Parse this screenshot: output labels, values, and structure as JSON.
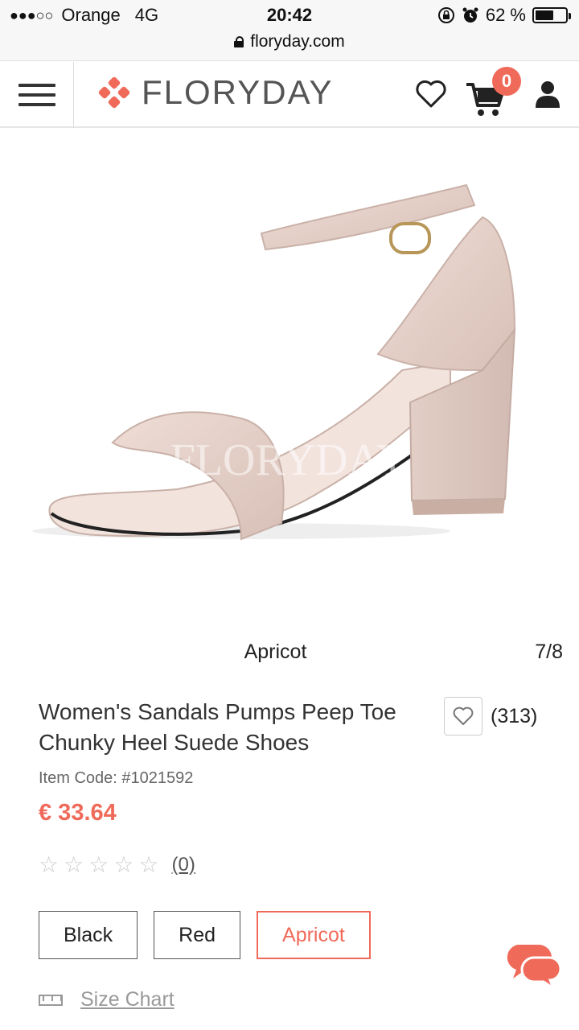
{
  "status": {
    "signal_dots": "●●●○○",
    "carrier": "Orange",
    "network": "4G",
    "time": "20:42",
    "battery": "62 %",
    "battery_level": 0.62,
    "url": "floryday.com"
  },
  "nav": {
    "brand": "FLORYDAY",
    "cart_count": "0",
    "accent": "#f06a5a"
  },
  "gallery": {
    "color_caption": "Apricot",
    "counter": "7/8",
    "watermark": "FLORYDAY"
  },
  "product": {
    "title": "Women's Sandals Pumps Peep Toe Chunky Heel Suede Shoes",
    "favorites_count": "(313)",
    "item_code": "Item Code: #1021592",
    "price": "€ 33.64",
    "rating_stars": 0,
    "rating_count": "(0)",
    "colors": [
      "Black",
      "Red",
      "Apricot"
    ],
    "selected_color": "Apricot",
    "size_chart": "Size Chart"
  }
}
